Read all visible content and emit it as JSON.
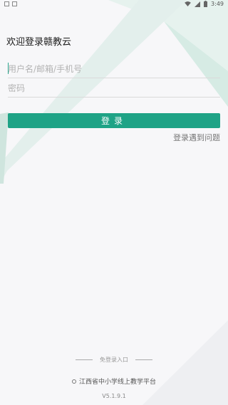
{
  "status_bar": {
    "time": "3:49"
  },
  "greeting": "欢迎登录赣教云",
  "form": {
    "username_placeholder": "用户名/邮箱/手机号",
    "password_placeholder": "密码",
    "login_label": "登录"
  },
  "help_link": "登录遇到问题",
  "footer": {
    "free_login_entry": "免登录入口",
    "platform_name": "江西省中小学线上教学平台",
    "version": "V5.1.9.1"
  },
  "colors": {
    "accent": "#1fa386",
    "background": "#f7f7f9"
  }
}
